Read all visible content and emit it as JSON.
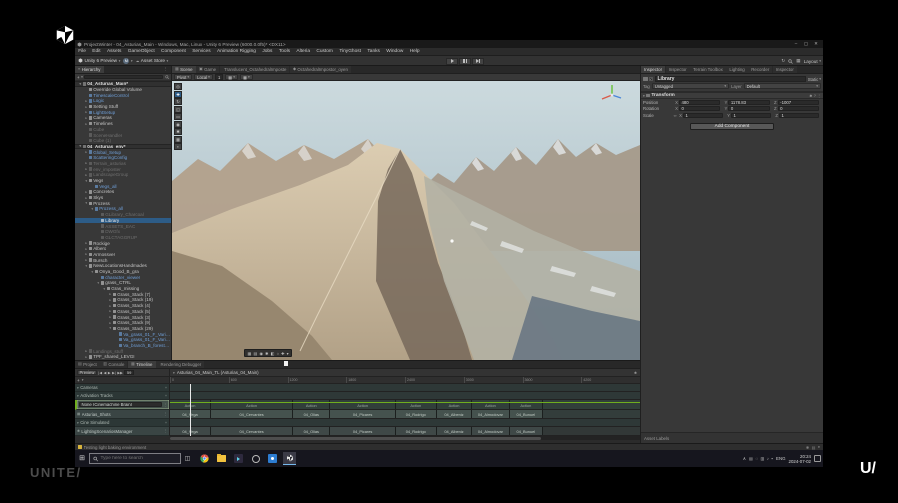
{
  "frame": {
    "unite_label": "UNITE/",
    "wordmark": "U/"
  },
  "window": {
    "title": "ProjectWinter - 04_Asturias_Main - Windows, Mac, Linux - Unity 6 Preview (6000.0.0f5)* <DX11>",
    "controls": {
      "min": "–",
      "max": "▢",
      "close": "✕"
    },
    "menus": [
      "File",
      "Edit",
      "Assets",
      "GameObject",
      "Component",
      "Services",
      "Animation Rigging",
      "Jobs",
      "Tools",
      "Alteria",
      "Custom",
      "TinyGhost",
      "Tanks",
      "Window",
      "Help"
    ]
  },
  "toolbar": {
    "version_label": "Unity 6 Preview",
    "account_label": "M",
    "asset_store_label": "Asset Store",
    "layout_label": "Layout"
  },
  "icons": {
    "dropdown": "▾",
    "expand": "▸",
    "more": "⋮",
    "menu": "≡",
    "plus": "+",
    "gear": "✱",
    "question": "?",
    "check": "✓",
    "link": "∞",
    "cloud": "☁",
    "caret_up": "∧",
    "start": "⊞",
    "taskview": "◫",
    "history": "↻",
    "grid": "▦",
    "transport_begin": "|◀",
    "transport_prev": "◀",
    "transport_play": "▶",
    "transport_next": "▶|",
    "transport_end": "▶▶"
  },
  "hierarchy": {
    "tab_label": "Hierarchy",
    "items": [
      {
        "label": "04_Asturias_Main*",
        "cls": "scene",
        "style": "padding-left:3px",
        "arrow": "▾"
      },
      {
        "label": "Override Global Volume",
        "cls": "norm",
        "style": "padding-left:9px",
        "arrow": ""
      },
      {
        "label": "TimescaleControl",
        "cls": "blue",
        "style": "padding-left:9px",
        "arrow": ""
      },
      {
        "label": "Logic",
        "cls": "blue",
        "style": "padding-left:9px",
        "arrow": "▸"
      },
      {
        "label": "Setting Stuff",
        "cls": "norm",
        "style": "padding-left:9px",
        "arrow": "▸"
      },
      {
        "label": "LightSetup",
        "cls": "blue",
        "style": "padding-left:9px",
        "arrow": "▸"
      },
      {
        "label": "Cameras",
        "cls": "norm",
        "style": "padding-left:9px",
        "arrow": "▸"
      },
      {
        "label": "Timelines",
        "cls": "norm",
        "style": "padding-left:9px",
        "arrow": "▸"
      },
      {
        "label": "Cube",
        "cls": "grey",
        "style": "padding-left:9px",
        "arrow": ""
      },
      {
        "label": "SceneHandler",
        "cls": "grey",
        "style": "padding-left:9px",
        "arrow": ""
      },
      {
        "label": "Cube (1)",
        "cls": "grey",
        "style": "padding-left:9px",
        "arrow": ""
      },
      {
        "label": "04_Asturias_env*",
        "cls": "scene",
        "style": "padding-left:3px",
        "arrow": "▾"
      },
      {
        "label": "Global_Setup",
        "cls": "blue",
        "style": "padding-left:9px",
        "arrow": "▸"
      },
      {
        "label": "ScatteringConfig",
        "cls": "blue",
        "style": "padding-left:9px",
        "arrow": ""
      },
      {
        "label": "Terrain_asturias",
        "cls": "grey",
        "style": "padding-left:9px",
        "arrow": "▸"
      },
      {
        "label": "env_imposter",
        "cls": "grey",
        "style": "padding-left:9px",
        "arrow": "▸"
      },
      {
        "label": "LandscapeGroup",
        "cls": "grey",
        "style": "padding-left:9px",
        "arrow": "▸"
      },
      {
        "label": "Vegs",
        "cls": "norm",
        "style": "padding-left:9px",
        "arrow": "▾"
      },
      {
        "label": "Vegs_all",
        "cls": "blue",
        "style": "padding-left:15px",
        "arrow": ""
      },
      {
        "label": "Concretes",
        "cls": "norm",
        "style": "padding-left:9px",
        "arrow": "▸"
      },
      {
        "label": "Skys",
        "cls": "norm",
        "style": "padding-left:9px",
        "arrow": "▸"
      },
      {
        "label": "Prozess",
        "cls": "norm",
        "style": "padding-left:9px",
        "arrow": "▾"
      },
      {
        "label": "Prozess_all",
        "cls": "blue",
        "style": "padding-left:15px",
        "arrow": "▾"
      },
      {
        "label": "GLibrary_Charcoal",
        "cls": "grey",
        "style": "padding-left:21px",
        "arrow": ""
      },
      {
        "label": "Library",
        "cls": "sel",
        "style": "padding-left:21px",
        "arrow": ""
      },
      {
        "label": "ASSETS_EAC",
        "cls": "grey",
        "style": "padding-left:21px",
        "arrow": ""
      },
      {
        "label": "DWGfx",
        "cls": "grey",
        "style": "padding-left:21px",
        "arrow": ""
      },
      {
        "label": "GLCTAGGRUP",
        "cls": "grey",
        "style": "padding-left:21px",
        "arrow": ""
      },
      {
        "label": "Rockige",
        "cls": "norm",
        "style": "padding-left:9px",
        "arrow": "▸"
      },
      {
        "label": "Albero",
        "cls": "norm",
        "style": "padding-left:9px",
        "arrow": "▸"
      },
      {
        "label": "Armossver",
        "cls": "norm",
        "style": "padding-left:9px",
        "arrow": "▸"
      },
      {
        "label": "Bursch",
        "cls": "norm",
        "style": "padding-left:9px",
        "arrow": "▸"
      },
      {
        "label": "NewLocationsHandmades",
        "cls": "norm",
        "style": "padding-left:9px",
        "arrow": "▾"
      },
      {
        "label": "Onya_Good_B_gra",
        "cls": "norm",
        "style": "padding-left:15px",
        "arrow": "▾"
      },
      {
        "label": "character_viewer",
        "cls": "blue",
        "style": "padding-left:21px",
        "arrow": ""
      },
      {
        "label": "grass_CTRL",
        "cls": "norm",
        "style": "padding-left:21px",
        "arrow": "▾"
      },
      {
        "label": "Gras_missing",
        "cls": "norm",
        "style": "padding-left:27px",
        "arrow": "▾"
      },
      {
        "label": "Grass_Stack (7)",
        "cls": "norm",
        "style": "padding-left:33px",
        "arrow": "▸"
      },
      {
        "label": "Grass_Stack (19)",
        "cls": "norm",
        "style": "padding-left:33px",
        "arrow": "▸"
      },
      {
        "label": "Grass_Stack (4)",
        "cls": "norm",
        "style": "padding-left:33px",
        "arrow": "▸"
      },
      {
        "label": "Grass_Stack (5)",
        "cls": "norm",
        "style": "padding-left:33px",
        "arrow": "▸"
      },
      {
        "label": "Grass_Stack (3)",
        "cls": "norm",
        "style": "padding-left:33px",
        "arrow": "▸"
      },
      {
        "label": "Grass_Stack (9)",
        "cls": "norm",
        "style": "padding-left:33px",
        "arrow": "▸"
      },
      {
        "label": "Grass_Stack (29)",
        "cls": "norm",
        "style": "padding-left:33px",
        "arrow": "▾"
      },
      {
        "label": "Va_grass_01_F_Vari01_LOD1",
        "cls": "blue",
        "style": "padding-left:39px",
        "arrow": ""
      },
      {
        "label": "Va_grass_01_F_Vari01_Green",
        "cls": "blue",
        "style": "padding-left:39px",
        "arrow": ""
      },
      {
        "label": "Va_branch_B_forest_LOD1",
        "cls": "blue",
        "style": "padding-left:39px",
        "arrow": ""
      },
      {
        "label": "Landings_stuff",
        "cls": "grey",
        "style": "padding-left:9px",
        "arrow": "▸"
      },
      {
        "label": "TPF_shared_LEVGI",
        "cls": "norm",
        "style": "padding-left:9px",
        "arrow": "▸"
      }
    ]
  },
  "scene": {
    "tabs": [
      {
        "label": "Scene",
        "cls": "on",
        "icon": "▦"
      },
      {
        "label": "Game",
        "cls": "",
        "icon": "▣"
      },
      {
        "label": "Translucent_OctahedralImposte",
        "cls": "",
        "icon": ""
      },
      {
        "label": "OctahedralImpostor_oyen",
        "cls": "",
        "icon": "◆"
      }
    ],
    "pivot_label": "Pivot",
    "local_label": "Local",
    "snap_value": "1",
    "tools": [
      {
        "g": "◎",
        "cls": ""
      },
      {
        "g": "✚",
        "cls": "sel"
      },
      {
        "g": "↻",
        "cls": ""
      },
      {
        "g": "◱",
        "cls": ""
      },
      {
        "g": "▭",
        "cls": ""
      },
      {
        "g": "◉",
        "cls": ""
      },
      {
        "g": "✱",
        "cls": ""
      },
      {
        "g": "▦",
        "cls": ""
      },
      {
        "g": "▪",
        "cls": ""
      }
    ],
    "overlay_icons": [
      "▦",
      "▤",
      "◉",
      "✱",
      "◧",
      "○",
      "✚",
      "▾"
    ]
  },
  "inspector": {
    "tabs": [
      {
        "label": "Inspector",
        "cls": "on"
      },
      {
        "label": "Inspector",
        "cls": ""
      },
      {
        "label": "Terrain Toolbox",
        "cls": ""
      },
      {
        "label": "Lighting",
        "cls": ""
      },
      {
        "label": "Recorder",
        "cls": ""
      },
      {
        "label": "Inspector",
        "cls": ""
      }
    ],
    "object_name": "Library",
    "static_label": "Static",
    "tag_label": "Tag",
    "tag_value": "Untagged",
    "layer_label": "Layer",
    "layer_value": "Default",
    "transform_title": "Transform",
    "axes": {
      "x": "X",
      "y": "Y",
      "z": "Z"
    },
    "rows": [
      {
        "label": "Position",
        "x": "480",
        "y": "1178.83",
        "z": "-1007"
      },
      {
        "label": "Rotation",
        "x": "0",
        "y": "0",
        "z": "0"
      },
      {
        "label": "Scale",
        "x": "1",
        "y": "1",
        "z": "1"
      }
    ],
    "add_component_label": "Add Component",
    "asset_labels_label": "Asset Labels"
  },
  "timeline": {
    "tabs": [
      {
        "label": "Project",
        "cls": "",
        "icon": "▤"
      },
      {
        "label": "Console",
        "cls": "",
        "icon": "▥"
      },
      {
        "label": "Timeline",
        "cls": "on",
        "icon": "▦"
      },
      {
        "label": "Rendering Debugger",
        "cls": "",
        "icon": ""
      }
    ],
    "preview_label": "Preview",
    "frame_value": "59",
    "asset_name": "Asturias_04_Main_TL (Asturias_04_Main)",
    "ruler_ticks": [
      "0",
      "600",
      "1200",
      "1800",
      "2400",
      "3000",
      "3600",
      "4200"
    ],
    "tracks": {
      "cameras": "Cameras",
      "activation": "Activation Tracks",
      "cine": "None (Cinemachine Brain)",
      "shots": "Asturias_Shots",
      "simulated": "Cine Simulated",
      "lighting": "LightingScenariosManager"
    },
    "action_clips": [
      {
        "label": "Action",
        "style": "width:11%"
      },
      {
        "label": "Action",
        "style": "width:22%"
      },
      {
        "label": "Action",
        "style": "width:10%"
      },
      {
        "label": "Action",
        "style": "width:17.5%"
      },
      {
        "label": "Action",
        "style": "width:11%"
      },
      {
        "label": "Action",
        "style": "width:9.5%"
      },
      {
        "label": "Action",
        "style": "width:10%"
      },
      {
        "label": "Action",
        "style": "width:9%"
      }
    ],
    "shot_clips": [
      {
        "label": "04_Vega",
        "style": "width:11%"
      },
      {
        "label": "04_Cervantes",
        "style": "width:22%"
      },
      {
        "label": "04_Olias",
        "style": "width:10%"
      },
      {
        "label": "04_Picares",
        "style": "width:17.5%"
      },
      {
        "label": "04_Rodrigo",
        "style": "width:11%"
      },
      {
        "label": "04_Albeniz",
        "style": "width:9.5%"
      },
      {
        "label": "04_Almodovar",
        "style": "width:10%"
      },
      {
        "label": "04_Bunuel",
        "style": "width:9%"
      }
    ],
    "lighting_clips": [
      {
        "label": "04_Vega",
        "style": "width:11%"
      },
      {
        "label": "04_Cervantes",
        "style": "width:22%"
      },
      {
        "label": "04_Olias",
        "style": "width:10%"
      },
      {
        "label": "04_Picares",
        "style": "width:17.5%"
      },
      {
        "label": "04_Rodrigo",
        "style": "width:11%"
      },
      {
        "label": "04_Albeniz",
        "style": "width:9.5%"
      },
      {
        "label": "04_Almodovar",
        "style": "width:10%"
      },
      {
        "label": "04_Bunuel",
        "style": "width:9%"
      }
    ]
  },
  "statusbar": {
    "message": "Testing light baking environment",
    "right_icons": [
      "✱",
      "▤",
      "●"
    ]
  },
  "taskbar": {
    "search_placeholder": "Type here to search",
    "lang": "ENG",
    "time": "20:24",
    "date": "2024-07-02",
    "tray_icons": [
      "▤",
      "◌",
      "▥",
      "♪",
      "▪"
    ]
  }
}
